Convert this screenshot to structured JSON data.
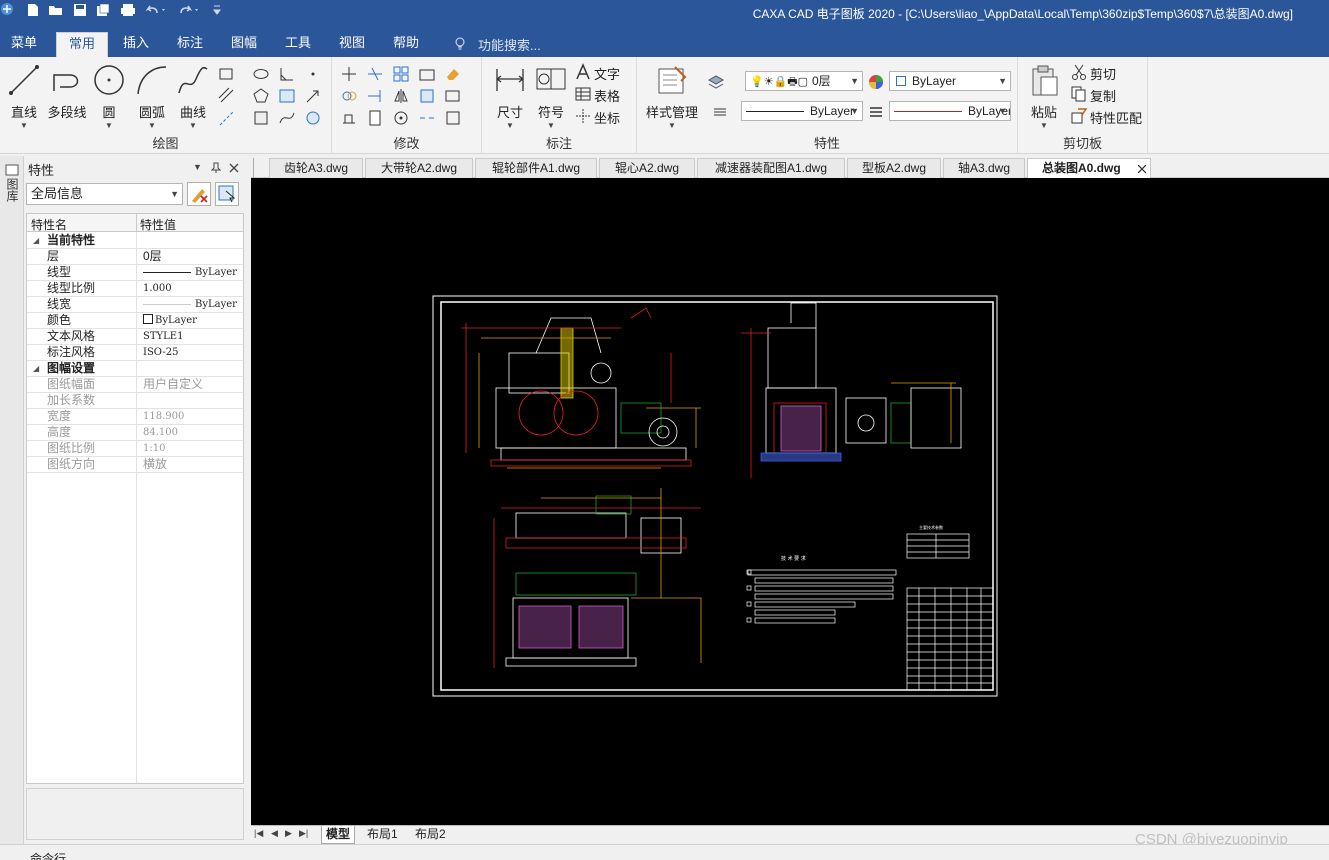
{
  "window": {
    "title": "CAXA CAD 电子图板 2020 - [C:\\Users\\liao_\\AppData\\Local\\Temp\\360zip$Temp\\360$7\\总装图A0.dwg]"
  },
  "menu": {
    "tabs": [
      "菜单",
      "常用",
      "插入",
      "标注",
      "图幅",
      "工具",
      "视图",
      "帮助"
    ],
    "active": "常用",
    "search_placeholder": "功能搜索..."
  },
  "ribbon": {
    "draw_group": {
      "label": "绘图",
      "buttons": [
        "直线",
        "多段线",
        "圆",
        "圆弧",
        "曲线"
      ]
    },
    "modify_group": {
      "label": "修改"
    },
    "annotate_group": {
      "label": "标注",
      "buttons": [
        "尺寸",
        "符号"
      ],
      "small": [
        "文字",
        "表格",
        "坐标"
      ]
    },
    "props_group": {
      "label": "特性",
      "style_button": "样式管理",
      "layer_value": "0层",
      "color_value": "ByLayer",
      "linetype_value": "ByLayer",
      "lineweight_value": "ByLayer"
    },
    "clipboard_group": {
      "label": "剪切板",
      "paste": "粘贴",
      "small": [
        "剪切",
        "复制",
        "特性匹配"
      ]
    }
  },
  "panel": {
    "title": "特性",
    "sidebar_label": "图库",
    "filter_value": "全局信息",
    "columns": [
      "特性名",
      "特性值"
    ],
    "sections": [
      {
        "name": "当前特性",
        "rows": [
          {
            "name": "层",
            "value": "0层"
          },
          {
            "name": "线型",
            "value": "ByLayer"
          },
          {
            "name": "线型比例",
            "value": "1.000"
          },
          {
            "name": "线宽",
            "value": "ByLayer"
          },
          {
            "name": "颜色",
            "value": "ByLayer"
          },
          {
            "name": "文本风格",
            "value": "STYLE1"
          },
          {
            "name": "标注风格",
            "value": "ISO-25"
          }
        ]
      },
      {
        "name": "图幅设置",
        "rows": [
          {
            "name": "图纸幅面",
            "value": "用户自定义"
          },
          {
            "name": "加长系数",
            "value": ""
          },
          {
            "name": "宽度",
            "value": "118.900"
          },
          {
            "name": "高度",
            "value": "84.100"
          },
          {
            "name": "图纸比例",
            "value": "1:10"
          },
          {
            "name": "图纸方向",
            "value": "横放"
          }
        ]
      }
    ]
  },
  "doc_tabs": [
    "齿轮A3.dwg",
    "大带轮A2.dwg",
    "辊轮部件A1.dwg",
    "辊心A2.dwg",
    "减速器装配图A1.dwg",
    "型板A2.dwg",
    "轴A3.dwg",
    "总装图A0.dwg"
  ],
  "active_doc": "总装图A0.dwg",
  "drawing": {
    "tech_title": "技 术 要 求",
    "table_title": "主要技术参数"
  },
  "layout_tabs": [
    "模型",
    "布局1",
    "布局2"
  ],
  "status": {
    "command_label": "命令行"
  },
  "watermark": "CSDN @biyezuopinvip",
  "colors": {
    "accent": "#2b579a",
    "canvas": "#000000",
    "drawing_yellow": "#e8d000",
    "drawing_red": "#e02020",
    "drawing_magenta": "#d060d0",
    "drawing_green": "#20a020"
  }
}
